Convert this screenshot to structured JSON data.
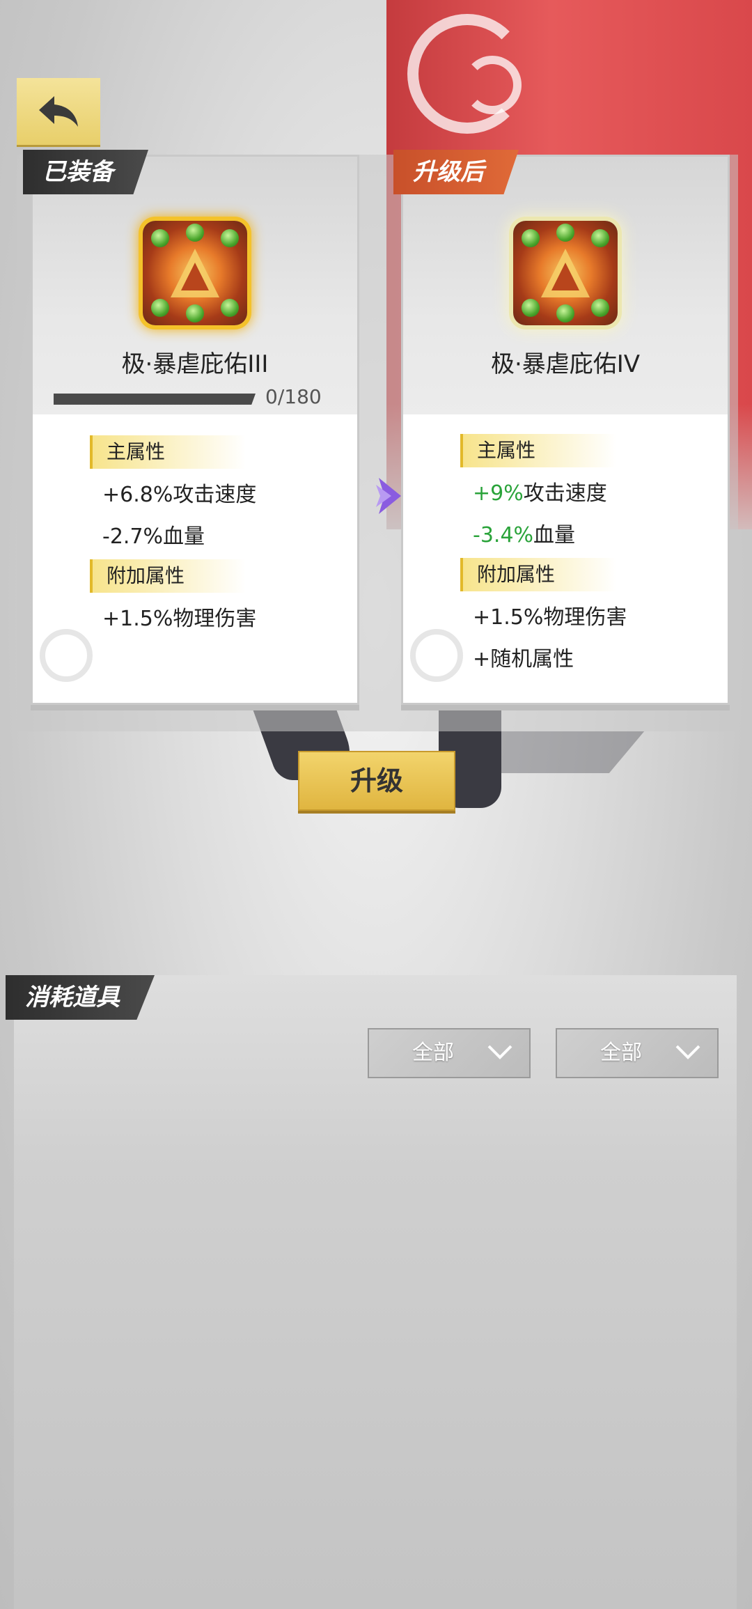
{
  "back_button": {
    "icon": "back-arrow-icon"
  },
  "equipped_card": {
    "tag": "已装备",
    "item_name": "极·暴虐庇佑III",
    "progress_text": "0/180",
    "progress_value": 0,
    "main_header": "主属性",
    "main_attrs": [
      "+6.8%攻击速度",
      "-2.7%血量"
    ],
    "extra_header": "附加属性",
    "extra_attrs": [
      "+1.5%物理伤害"
    ]
  },
  "upgraded_card": {
    "tag": "升级后",
    "item_name": "极·暴虐庇佑IV",
    "main_header": "主属性",
    "main_attrs": [
      {
        "value": "+9%",
        "label": "攻击速度"
      },
      {
        "value": "-3.4%",
        "label": "血量"
      }
    ],
    "extra_header": "附加属性",
    "extra_attrs": [
      "+1.5%物理伤害",
      "+随机属性"
    ]
  },
  "upgrade_button": {
    "label": "升级"
  },
  "consume_panel": {
    "tag": "消耗道具",
    "filter1": "全部",
    "filter2": "全部"
  },
  "colors": {
    "highlight_green": "#2aa33a",
    "gold": "#e8cf6a",
    "equipped_tag": "#2e2e2e",
    "upgrade_tag": "#d05a2e"
  }
}
